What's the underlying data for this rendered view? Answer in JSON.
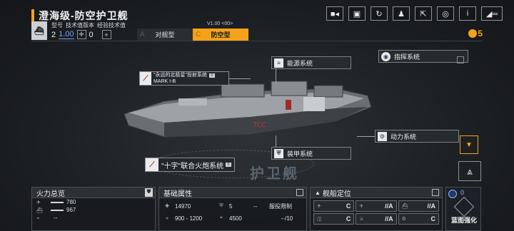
{
  "title": "澄海级-防空护卫舰",
  "top_icons": [
    "video-icon",
    "image-icon",
    "refresh-icon",
    "person-icon",
    "share-icon",
    "target-icon",
    "info-icon",
    "return-icon"
  ],
  "version": {
    "labels": [
      "型号",
      "技术值版本",
      "经验技术值"
    ],
    "model_number": "2",
    "tech_version": "1.00",
    "exp_value": "0",
    "version_code": "V1.00 <00>",
    "modes": [
      {
        "letter": "A",
        "label": "对舰型"
      },
      {
        "letter": "C",
        "label": "防空型"
      }
    ],
    "currency": "5"
  },
  "systems": {
    "energy": "能源系统",
    "command": "指挥系统",
    "power": "动力系统",
    "armor": "装甲系统"
  },
  "weapons": {
    "main": {
      "line1": "\"永远的北极星\"投射系统",
      "line2": "MARK I-B"
    },
    "secondary": "\"十字\"联合火炮系统"
  },
  "ship_class": "护卫舰",
  "firepower": {
    "title": "火力总览",
    "rows": [
      {
        "icon": "air-icon",
        "value": "780"
      },
      {
        "icon": "ship-icon",
        "value": "967"
      },
      {
        "icon": "sub-icon",
        "value": "--"
      }
    ]
  },
  "attributes": {
    "title": "基础属性",
    "hp": "14970",
    "armor": "5",
    "extra": "--",
    "service_label": "服役限制",
    "speed": "900 - 1200",
    "range": "4500",
    "service_value": "--/10"
  },
  "positioning": {
    "title": "舰船定位",
    "cells": [
      "C",
      "//A",
      "//A",
      "C",
      "//A",
      "C"
    ]
  },
  "blueprint": {
    "count": "0",
    "label": "蓝图强化"
  },
  "colors": {
    "accent": "#f3a21a",
    "panel": "#181a1e",
    "blue": "#6aa7ff"
  }
}
